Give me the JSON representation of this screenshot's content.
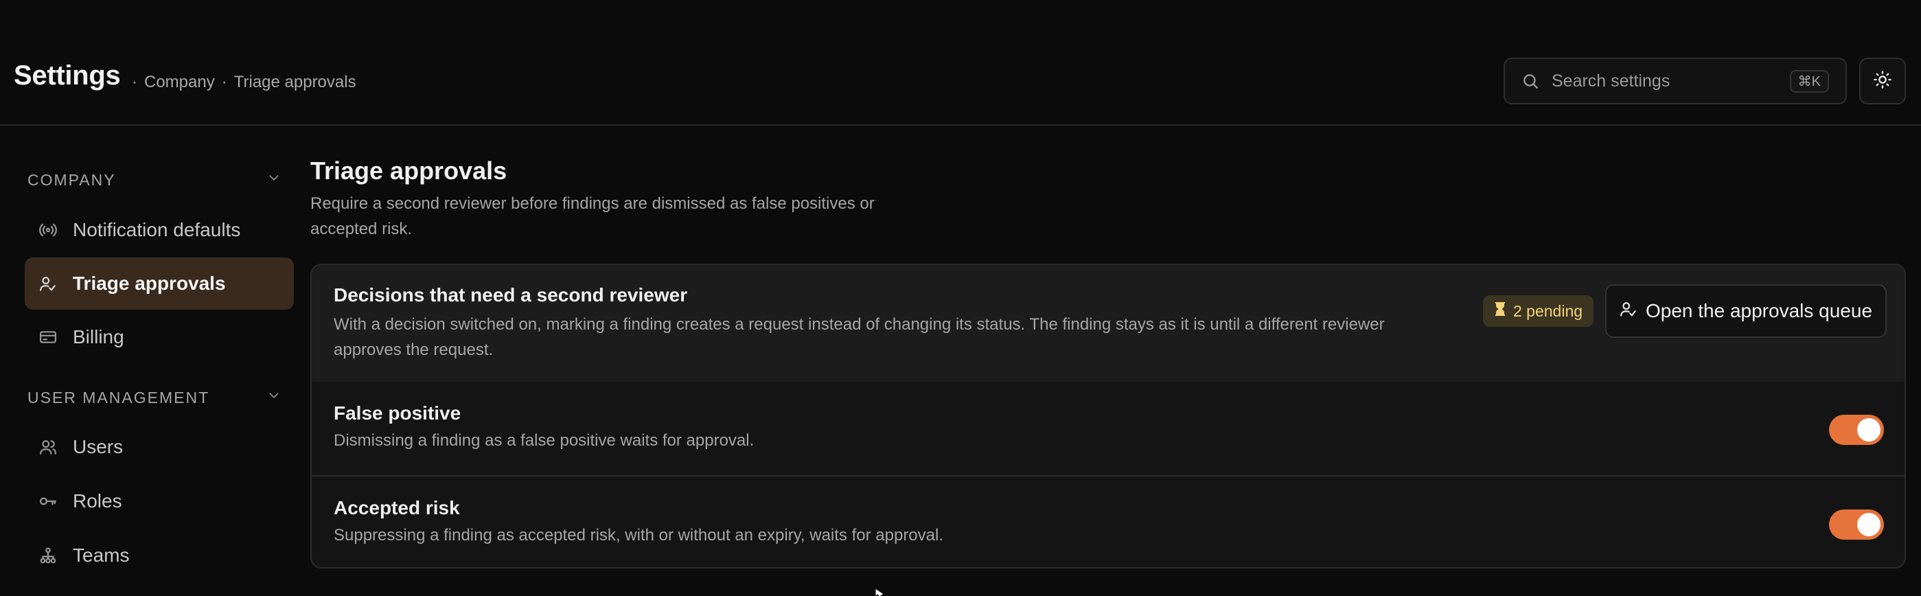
{
  "header": {
    "title": "Settings",
    "breadcrumb": [
      "·",
      "Company",
      "·",
      "Triage approvals"
    ],
    "search": {
      "placeholder": "Search settings",
      "shortcut": "⌘K",
      "icon": "search-icon"
    },
    "theme_icon": "sun-icon"
  },
  "sidebar": {
    "sections": [
      {
        "label": "COMPANY",
        "items": [
          {
            "label": "Notification defaults",
            "icon": "broadcast-icon"
          },
          {
            "label": "Triage approvals",
            "icon": "user-check-icon",
            "active": true
          },
          {
            "label": "Billing",
            "icon": "credit-card-icon"
          }
        ]
      },
      {
        "label": "USER MANAGEMENT",
        "items": [
          {
            "label": "Users",
            "icon": "users-icon"
          },
          {
            "label": "Roles",
            "icon": "key-icon"
          },
          {
            "label": "Teams",
            "icon": "org-chart-icon"
          }
        ]
      }
    ]
  },
  "main": {
    "title": "Triage approvals",
    "description": "Require a second reviewer before findings are dismissed as false positives or accepted risk.",
    "card": {
      "title": "Decisions that need a second reviewer",
      "description": "With a decision switched on, marking a finding creates a request instead of changing its status. The finding stays as it is until a different reviewer approves the request.",
      "pending_badge": "2 pending",
      "queue_button": "Open the approvals queue",
      "rows": [
        {
          "title": "False positive",
          "description": "Dismissing a finding as a false positive waits for approval.",
          "enabled": true
        },
        {
          "title": "Accepted risk",
          "description": "Suppressing a finding as accepted risk, with or without an expiry, waits for approval.",
          "enabled": true
        }
      ]
    }
  },
  "colors": {
    "accent": "#e5733a",
    "active_nav": "#3a2a1e",
    "badge_bg": "#3b3420",
    "badge_text": "#f3d27a"
  }
}
